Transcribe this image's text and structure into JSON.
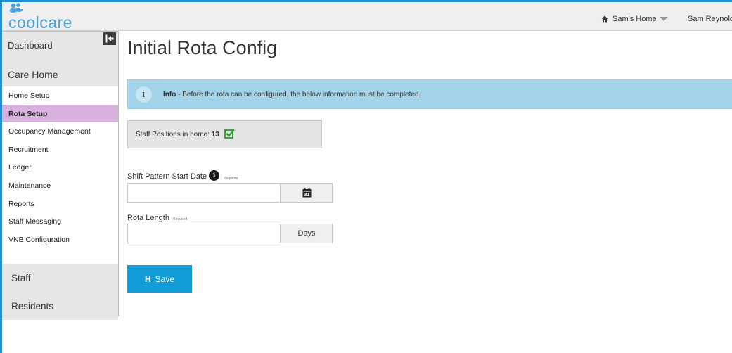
{
  "brand": {
    "logo_text": "coolcare",
    "accent": "#1e8fd6",
    "logo_color": "#4aa3df"
  },
  "header": {
    "home_selector": "Sam's Home",
    "user_name": "Sam Reynolds"
  },
  "sidebar": {
    "dashboard": "Dashboard",
    "care_home": "Care Home",
    "items": [
      {
        "label": "Home Setup",
        "active": false
      },
      {
        "label": "Rota Setup",
        "active": true
      },
      {
        "label": "Occupancy Management",
        "active": false
      },
      {
        "label": "Recruitment",
        "active": false
      },
      {
        "label": "Ledger",
        "active": false
      },
      {
        "label": "Maintenance",
        "active": false
      },
      {
        "label": "Reports",
        "active": false
      },
      {
        "label": "Staff Messaging",
        "active": false
      },
      {
        "label": "VNB Configuration",
        "active": false
      }
    ],
    "staff": "Staff",
    "residents": "Residents",
    "active_color": "#d8b1de"
  },
  "main": {
    "title": "Initial Rota Config",
    "info": {
      "label": "Info",
      "message": " - Before the rota can be configured, the below information must be completed.",
      "color": "#a3d3e8"
    },
    "staff_positions": {
      "label": "Staff Positions in home: ",
      "count": "13"
    },
    "shift_start": {
      "label": "Shift Pattern Start Date",
      "required": "Required",
      "value": ""
    },
    "rota_length": {
      "label": "Rota Length",
      "required": "Required",
      "value": "",
      "unit": "Days"
    },
    "save": {
      "label": "Save",
      "color": "#139dd8"
    }
  }
}
